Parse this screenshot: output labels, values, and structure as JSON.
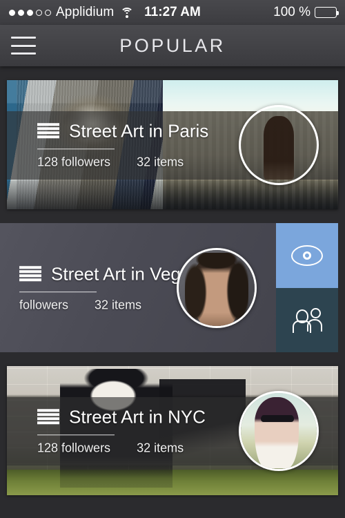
{
  "status_bar": {
    "carrier": "Applidium",
    "signal_dots_filled": 3,
    "signal_dots_total": 5,
    "wifi_icon": "wifi-icon",
    "time": "11:27 AM",
    "battery_percent": "100 %",
    "battery_icon": "battery-full-icon"
  },
  "nav": {
    "menu_icon": "hamburger-menu-icon",
    "title": "POPULAR"
  },
  "colors": {
    "page_background": "#2b2b2e",
    "navbar": "#434347",
    "action_view": "#7ba6dc",
    "action_follow": "#2d4450",
    "swiped_surface": "#4b4b55",
    "text": "#ffffff"
  },
  "cards": [
    {
      "list_icon": "list-stack-icon",
      "title": "Street Art in Paris",
      "followers": "128 followers",
      "items": "32 items",
      "avatar_icon": "avatar-sunset-silhouette",
      "state": "normal"
    },
    {
      "list_icon": "list-stack-icon",
      "title": "Street Art in Vegas",
      "followers": "followers",
      "items": "32 items",
      "avatar_icon": "avatar-man-long-hair",
      "state": "swiped",
      "actions": [
        {
          "label_icon": "eye-icon",
          "name": "view-action"
        },
        {
          "label_icon": "people-group-icon",
          "name": "follow-action"
        }
      ]
    },
    {
      "list_icon": "list-stack-icon",
      "title": "Street Art in NYC",
      "followers": "128 followers",
      "items": "32 items",
      "avatar_icon": "avatar-woman-sunglasses",
      "state": "normal"
    }
  ]
}
